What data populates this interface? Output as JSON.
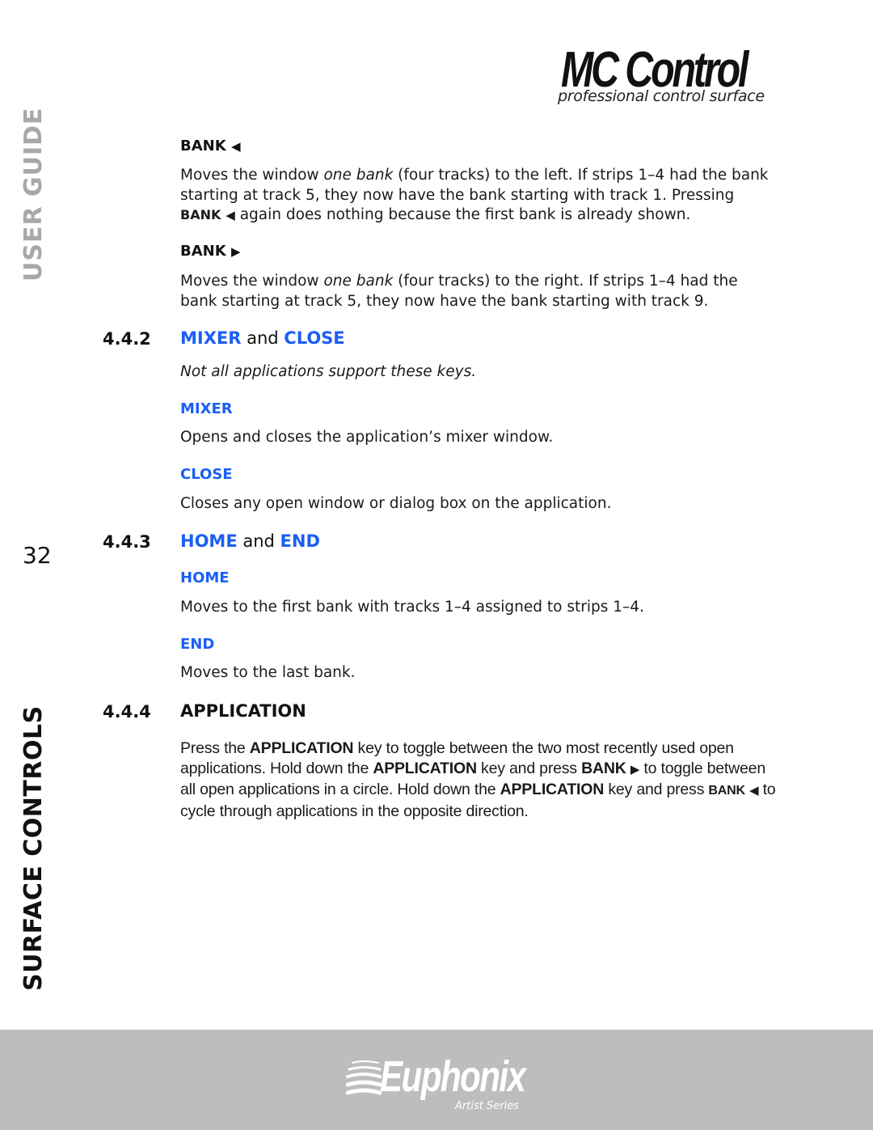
{
  "header": {
    "logo_title": "MC Control",
    "logo_subtitle": "professional control surface"
  },
  "sidebar": {
    "top_label": "USER GUIDE",
    "bottom_label": "SURFACE CONTROLS",
    "page_number": "32"
  },
  "content": {
    "bank_left": {
      "heading": "BANK",
      "icon": "triangle-left-icon",
      "para": {
        "t1": "Moves the window ",
        "em": "one bank",
        "t2": " (four tracks) to the left. If strips 1–4 had the bank starting at track 5, they now have the bank starting with track 1. Pressing ",
        "key": "BANK",
        "t3": " again does nothing because the first bank is already shown."
      }
    },
    "bank_right": {
      "heading": "BANK",
      "icon": "triangle-right-icon",
      "para": {
        "t1": "Moves the window ",
        "em": "one bank",
        "t2": " (four tracks) to the right. If strips 1–4 had the bank starting at track 5, they now have the bank starting with track 9."
      }
    },
    "sec_442": {
      "number": "4.4.2",
      "title_a": "MIXER",
      "title_and": " and ",
      "title_b": "CLOSE",
      "note": "Not all applications support these keys.",
      "mixer_heading": "MIXER",
      "mixer_text": "Opens and closes the application’s mixer window.",
      "close_heading": "CLOSE",
      "close_text": "Closes any open window or dialog box on the application."
    },
    "sec_443": {
      "number": "4.4.3",
      "title_a": "HOME",
      "title_and": " and ",
      "title_b": "END",
      "home_heading": "HOME",
      "home_text": "Moves to the first bank with tracks 1–4 assigned to strips 1–4.",
      "end_heading": "END",
      "end_text": "Moves to the last bank."
    },
    "sec_444": {
      "number": "4.4.4",
      "title": "APPLICATION",
      "para": {
        "t1": "Press the ",
        "k1": "APPLICATION",
        "t2": " key to toggle between the two most recently used open applications. Hold down the ",
        "k2": "APPLICATION",
        "t3": " key and press ",
        "k3": "BANK",
        "t4": " to toggle be­tween all open applications in a circle. Hold down the ",
        "k4": "APPLICATION",
        "t5": " key and press ",
        "k5": "BANK",
        "t6": " to cycle through applications in the opposite direction."
      }
    }
  },
  "footer": {
    "brand": "Euphonix",
    "series": "Artist Series"
  },
  "colors": {
    "accent_blue": "#1a5ef5",
    "footer_gray": "#bcbdbf",
    "sidebar_gray": "#a8a8a8"
  }
}
